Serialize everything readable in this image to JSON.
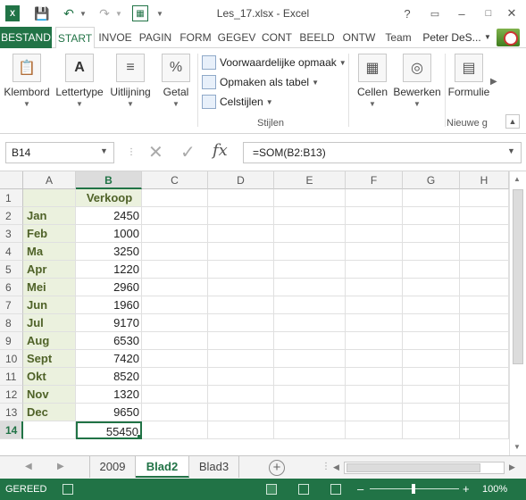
{
  "window": {
    "title": "Les_17.xlsx - Excel",
    "help": "?",
    "quick_access": [
      "save-icon",
      "undo-icon",
      "redo-icon",
      "customize-icon"
    ]
  },
  "ribbon_tabs": [
    "BESTAND",
    "START",
    "INVOE",
    "PAGIN",
    "FORM",
    "GEGEV",
    "CONT",
    "BEELD",
    "ONTW",
    "Team"
  ],
  "active_tab": "START",
  "user_name": "Peter DeS...",
  "ribbon": {
    "clipboard": "Klembord",
    "font": "Lettertype",
    "alignment": "Uitlijning",
    "number": "Getal",
    "number_icon": "%",
    "conditional_formatting": "Voorwaardelijke opmaak",
    "format_as_table": "Opmaken als tabel",
    "cell_styles": "Celstijlen",
    "styles_group": "Stijlen",
    "cells": "Cellen",
    "editing": "Bewerken",
    "form": "Formulie",
    "new_group": "Nieuwe g"
  },
  "formula_bar": {
    "name_box": "B14",
    "fx": "fx",
    "formula": "=SOM(B2:B13)"
  },
  "columns": [
    "A",
    "B",
    "C",
    "D",
    "E",
    "F",
    "G",
    "H"
  ],
  "selected_column": "B",
  "rows": [
    "1",
    "2",
    "3",
    "4",
    "5",
    "6",
    "7",
    "8",
    "9",
    "10",
    "11",
    "12",
    "13",
    "14"
  ],
  "selected_row": "14",
  "header_b1": "Verkoop",
  "months": [
    "Jan",
    "Feb",
    "Ma",
    "Apr",
    "Mei",
    "Jun",
    "Jul",
    "Aug",
    "Sept",
    "Okt",
    "Nov",
    "Dec"
  ],
  "values": [
    "2450",
    "1000",
    "3250",
    "1220",
    "2960",
    "1960",
    "9170",
    "6530",
    "7420",
    "8520",
    "1320",
    "9650"
  ],
  "total": "55450",
  "sheets": [
    "2009",
    "Blad2",
    "Blad3"
  ],
  "active_sheet": "Blad2",
  "status": {
    "ready": "GEREED",
    "zoom": "100%",
    "zoom_percent": 100
  },
  "colors": {
    "accent": "#217346",
    "label_fill": "#ebf1de",
    "label_text": "#4f6228"
  }
}
